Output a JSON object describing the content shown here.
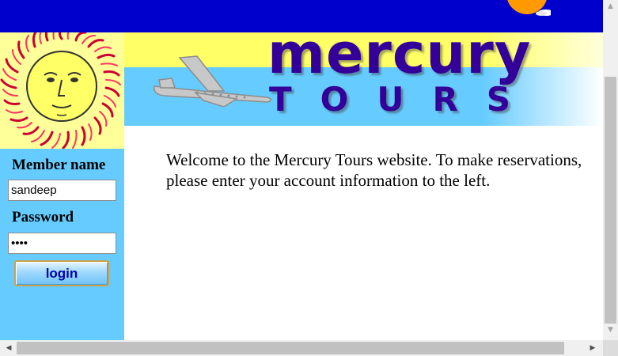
{
  "banner": {
    "title": "mercury",
    "subtitle": "TOURS"
  },
  "sidebar": {
    "member_label": "Member name",
    "member_value": "sandeep",
    "password_label": "Password",
    "password_value": "abcd",
    "login_label": "login"
  },
  "main": {
    "welcome_text": "Welcome to the Mercury Tours website. To make reservations, please enter your account information to the left."
  },
  "icons": {
    "top_sun": "sun-cloud-icon",
    "logo": "sun-face-icon",
    "plane": "airplane-icon",
    "scroll_up": "arrow-up-icon",
    "scroll_down": "arrow-down-icon",
    "scroll_left": "arrow-left-icon",
    "scroll_right": "arrow-right-icon"
  },
  "colors": {
    "top_bar": "#0000cc",
    "sidebar": "#66ccff",
    "brand_text": "#330099",
    "banner_yellow": "#ffff66"
  }
}
